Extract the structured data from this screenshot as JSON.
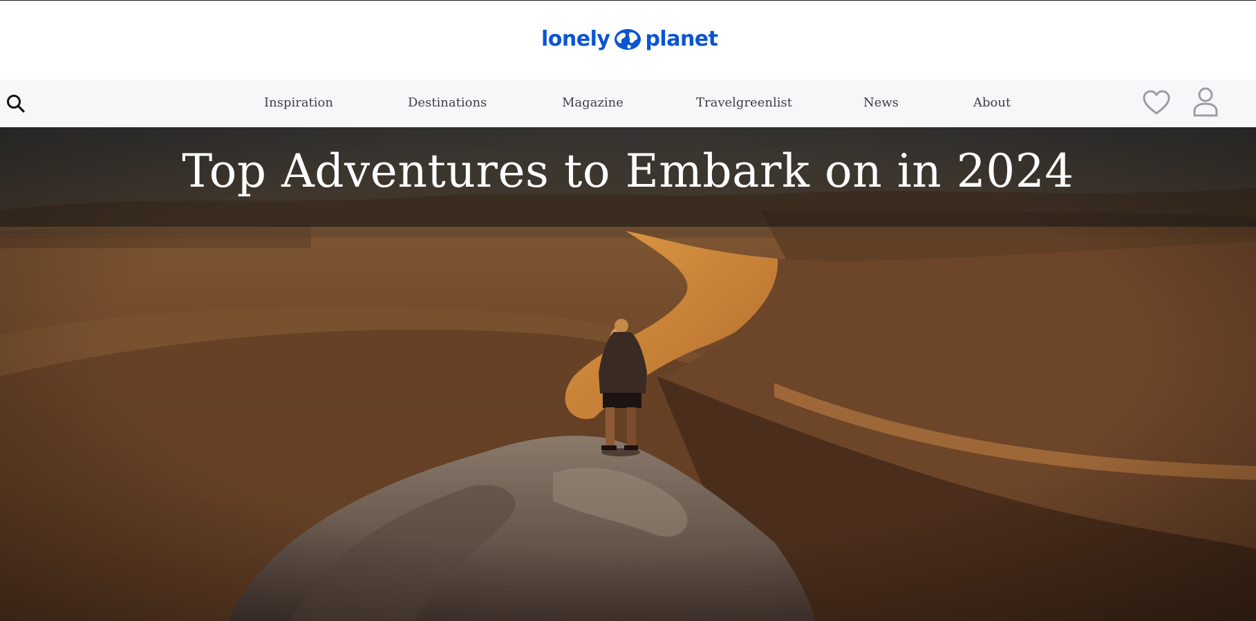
{
  "header": {
    "logo_text_left": "lonely",
    "logo_text_right": "planet",
    "logo_icon": "globe-icon",
    "brand_color": "#0a55d1"
  },
  "nav": {
    "search_icon": "search-icon",
    "items": [
      {
        "label": "Inspiration"
      },
      {
        "label": "Destinations"
      },
      {
        "label": "Magazine"
      },
      {
        "label": "Travelgreenlist"
      },
      {
        "label": "News"
      },
      {
        "label": "About"
      }
    ],
    "favorites_icon": "heart-icon",
    "account_icon": "user-icon",
    "background": "#f6f7f9"
  },
  "hero": {
    "title": "Top Adventures to Embark on in 2024",
    "image_subject": "person standing on top of a sand dune in the desert at sunset"
  }
}
